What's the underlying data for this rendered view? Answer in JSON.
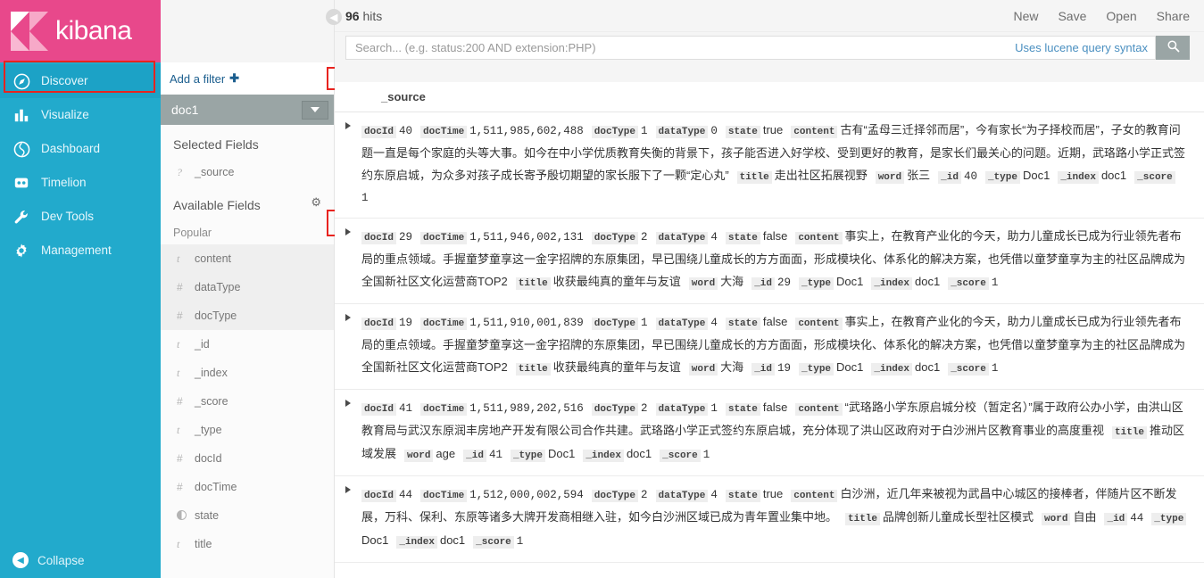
{
  "brand": {
    "name": "kibana",
    "logo_icon": "kibana-logo"
  },
  "nav": {
    "items": [
      {
        "label": "Discover",
        "icon": "compass-icon",
        "active": true
      },
      {
        "label": "Visualize",
        "icon": "bar-chart-icon",
        "active": false
      },
      {
        "label": "Dashboard",
        "icon": "dashboard-icon",
        "active": false
      },
      {
        "label": "Timelion",
        "icon": "timelion-icon",
        "active": false
      },
      {
        "label": "Dev Tools",
        "icon": "wrench-icon",
        "active": false
      },
      {
        "label": "Management",
        "icon": "gear-icon",
        "active": false
      }
    ],
    "collapse_label": "Collapse",
    "collapse_icon": "chevron-left-icon"
  },
  "header": {
    "hits_count": "96",
    "hits_label": "hits",
    "actions": [
      "New",
      "Save",
      "Open",
      "Share"
    ]
  },
  "search": {
    "value": "",
    "placeholder": "Search... (e.g. status:200 AND extension:PHP)",
    "hint": "Uses lucene query syntax",
    "button_icon": "search-icon"
  },
  "sidebar": {
    "add_filter_label": "Add a filter",
    "add_filter_icon": "plus-icon",
    "index_pattern": "doc1",
    "index_caret_icon": "chevron-down-icon",
    "selected_fields_title": "Selected Fields",
    "selected_fields": [
      {
        "name": "_source",
        "type": "?"
      }
    ],
    "available_fields_title": "Available Fields",
    "settings_icon": "gear-icon",
    "popular_title": "Popular",
    "popular_fields": [
      {
        "name": "content",
        "type": "t"
      },
      {
        "name": "dataType",
        "type": "#"
      },
      {
        "name": "docType",
        "type": "#"
      }
    ],
    "fields": [
      {
        "name": "_id",
        "type": "t"
      },
      {
        "name": "_index",
        "type": "t"
      },
      {
        "name": "_score",
        "type": "#"
      },
      {
        "name": "_type",
        "type": "t"
      },
      {
        "name": "docId",
        "type": "#"
      },
      {
        "name": "docTime",
        "type": "#"
      },
      {
        "name": "state",
        "type": "b"
      },
      {
        "name": "title",
        "type": "t"
      }
    ]
  },
  "table": {
    "column_header": "_source",
    "expand_icon": "caret-right-icon",
    "rows": [
      {
        "fields": [
          {
            "key": "docId",
            "value": "40"
          },
          {
            "key": "docTime",
            "value": "1,511,985,602,488"
          },
          {
            "key": "docType",
            "value": "1"
          },
          {
            "key": "dataType",
            "value": "0"
          },
          {
            "key": "state",
            "value": "true"
          },
          {
            "key": "content",
            "value": "古有“孟母三迁择邻而居”，今有家长“为子择校而居”，子女的教育问题一直是每个家庭的头等大事。如今在中小学优质教育失衡的背景下，孩子能否进入好学校、受到更好的教育，是家长们最关心的问题。近期，武珞路小学正式签约东原启城，为众多对孩子成长寄予殷切期望的家长服下了一颗“定心丸”"
          },
          {
            "key": "title",
            "value": "走出社区拓展视野"
          },
          {
            "key": "word",
            "value": "张三"
          },
          {
            "key": "_id",
            "value": "40"
          },
          {
            "key": "_type",
            "value": "Doc1"
          },
          {
            "key": "_index",
            "value": "doc1"
          },
          {
            "key": "_score",
            "value": "1"
          }
        ]
      },
      {
        "fields": [
          {
            "key": "docId",
            "value": "29"
          },
          {
            "key": "docTime",
            "value": "1,511,946,002,131"
          },
          {
            "key": "docType",
            "value": "2"
          },
          {
            "key": "dataType",
            "value": "4"
          },
          {
            "key": "state",
            "value": "false"
          },
          {
            "key": "content",
            "value": "事实上，在教育产业化的今天，助力儿童成长已成为行业领先者布局的重点领域。手握童梦童享这一金字招牌的东原集团，早已围绕儿童成长的方方面面，形成模块化、体系化的解决方案，也凭借以童梦童享为主的社区品牌成为全国新社区文化运营商TOP2"
          },
          {
            "key": "title",
            "value": "收获最纯真的童年与友谊"
          },
          {
            "key": "word",
            "value": "大海"
          },
          {
            "key": "_id",
            "value": "29"
          },
          {
            "key": "_type",
            "value": "Doc1"
          },
          {
            "key": "_index",
            "value": "doc1"
          },
          {
            "key": "_score",
            "value": "1"
          }
        ]
      },
      {
        "fields": [
          {
            "key": "docId",
            "value": "19"
          },
          {
            "key": "docTime",
            "value": "1,511,910,001,839"
          },
          {
            "key": "docType",
            "value": "1"
          },
          {
            "key": "dataType",
            "value": "4"
          },
          {
            "key": "state",
            "value": "false"
          },
          {
            "key": "content",
            "value": "事实上，在教育产业化的今天，助力儿童成长已成为行业领先者布局的重点领域。手握童梦童享这一金字招牌的东原集团，早已围绕儿童成长的方方面面，形成模块化、体系化的解决方案，也凭借以童梦童享为主的社区品牌成为全国新社区文化运营商TOP2"
          },
          {
            "key": "title",
            "value": "收获最纯真的童年与友谊"
          },
          {
            "key": "word",
            "value": "大海"
          },
          {
            "key": "_id",
            "value": "19"
          },
          {
            "key": "_type",
            "value": "Doc1"
          },
          {
            "key": "_index",
            "value": "doc1"
          },
          {
            "key": "_score",
            "value": "1"
          }
        ]
      },
      {
        "fields": [
          {
            "key": "docId",
            "value": "41"
          },
          {
            "key": "docTime",
            "value": "1,511,989,202,516"
          },
          {
            "key": "docType",
            "value": "2"
          },
          {
            "key": "dataType",
            "value": "1"
          },
          {
            "key": "state",
            "value": "false"
          },
          {
            "key": "content",
            "value": "“武珞路小学东原启城分校（暂定名）”属于政府公办小学，由洪山区教育局与武汉东原润丰房地产开发有限公司合作共建。武珞路小学正式签约东原启城，充分体现了洪山区政府对于白沙洲片区教育事业的高度重视"
          },
          {
            "key": "title",
            "value": "推动区域发展"
          },
          {
            "key": "word",
            "value": "age"
          },
          {
            "key": "_id",
            "value": "41"
          },
          {
            "key": "_type",
            "value": "Doc1"
          },
          {
            "key": "_index",
            "value": "doc1"
          },
          {
            "key": "_score",
            "value": "1"
          }
        ]
      },
      {
        "fields": [
          {
            "key": "docId",
            "value": "44"
          },
          {
            "key": "docTime",
            "value": "1,512,000,002,594"
          },
          {
            "key": "docType",
            "value": "2"
          },
          {
            "key": "dataType",
            "value": "4"
          },
          {
            "key": "state",
            "value": "true"
          },
          {
            "key": "content",
            "value": "白沙洲，近几年来被视为武昌中心城区的接棒者，伴随片区不断发展，万科、保利、东原等诸多大牌开发商相继入驻，如今白沙洲区域已成为青年置业集中地。"
          },
          {
            "key": "title",
            "value": "品牌创新儿童成长型社区模式"
          },
          {
            "key": "word",
            "value": "自由"
          },
          {
            "key": "_id",
            "value": "44"
          },
          {
            "key": "_type",
            "value": "Doc1"
          },
          {
            "key": "_index",
            "value": "doc1"
          },
          {
            "key": "_score",
            "value": "1"
          }
        ]
      }
    ]
  },
  "colors": {
    "brand_pink": "#e8488b",
    "nav_blue": "#22aacc",
    "nav_active_blue": "#1ca2c6",
    "annotation_red": "#e8231f",
    "link_blue": "#1b5e8e",
    "index_gray": "#9aa5a5"
  }
}
